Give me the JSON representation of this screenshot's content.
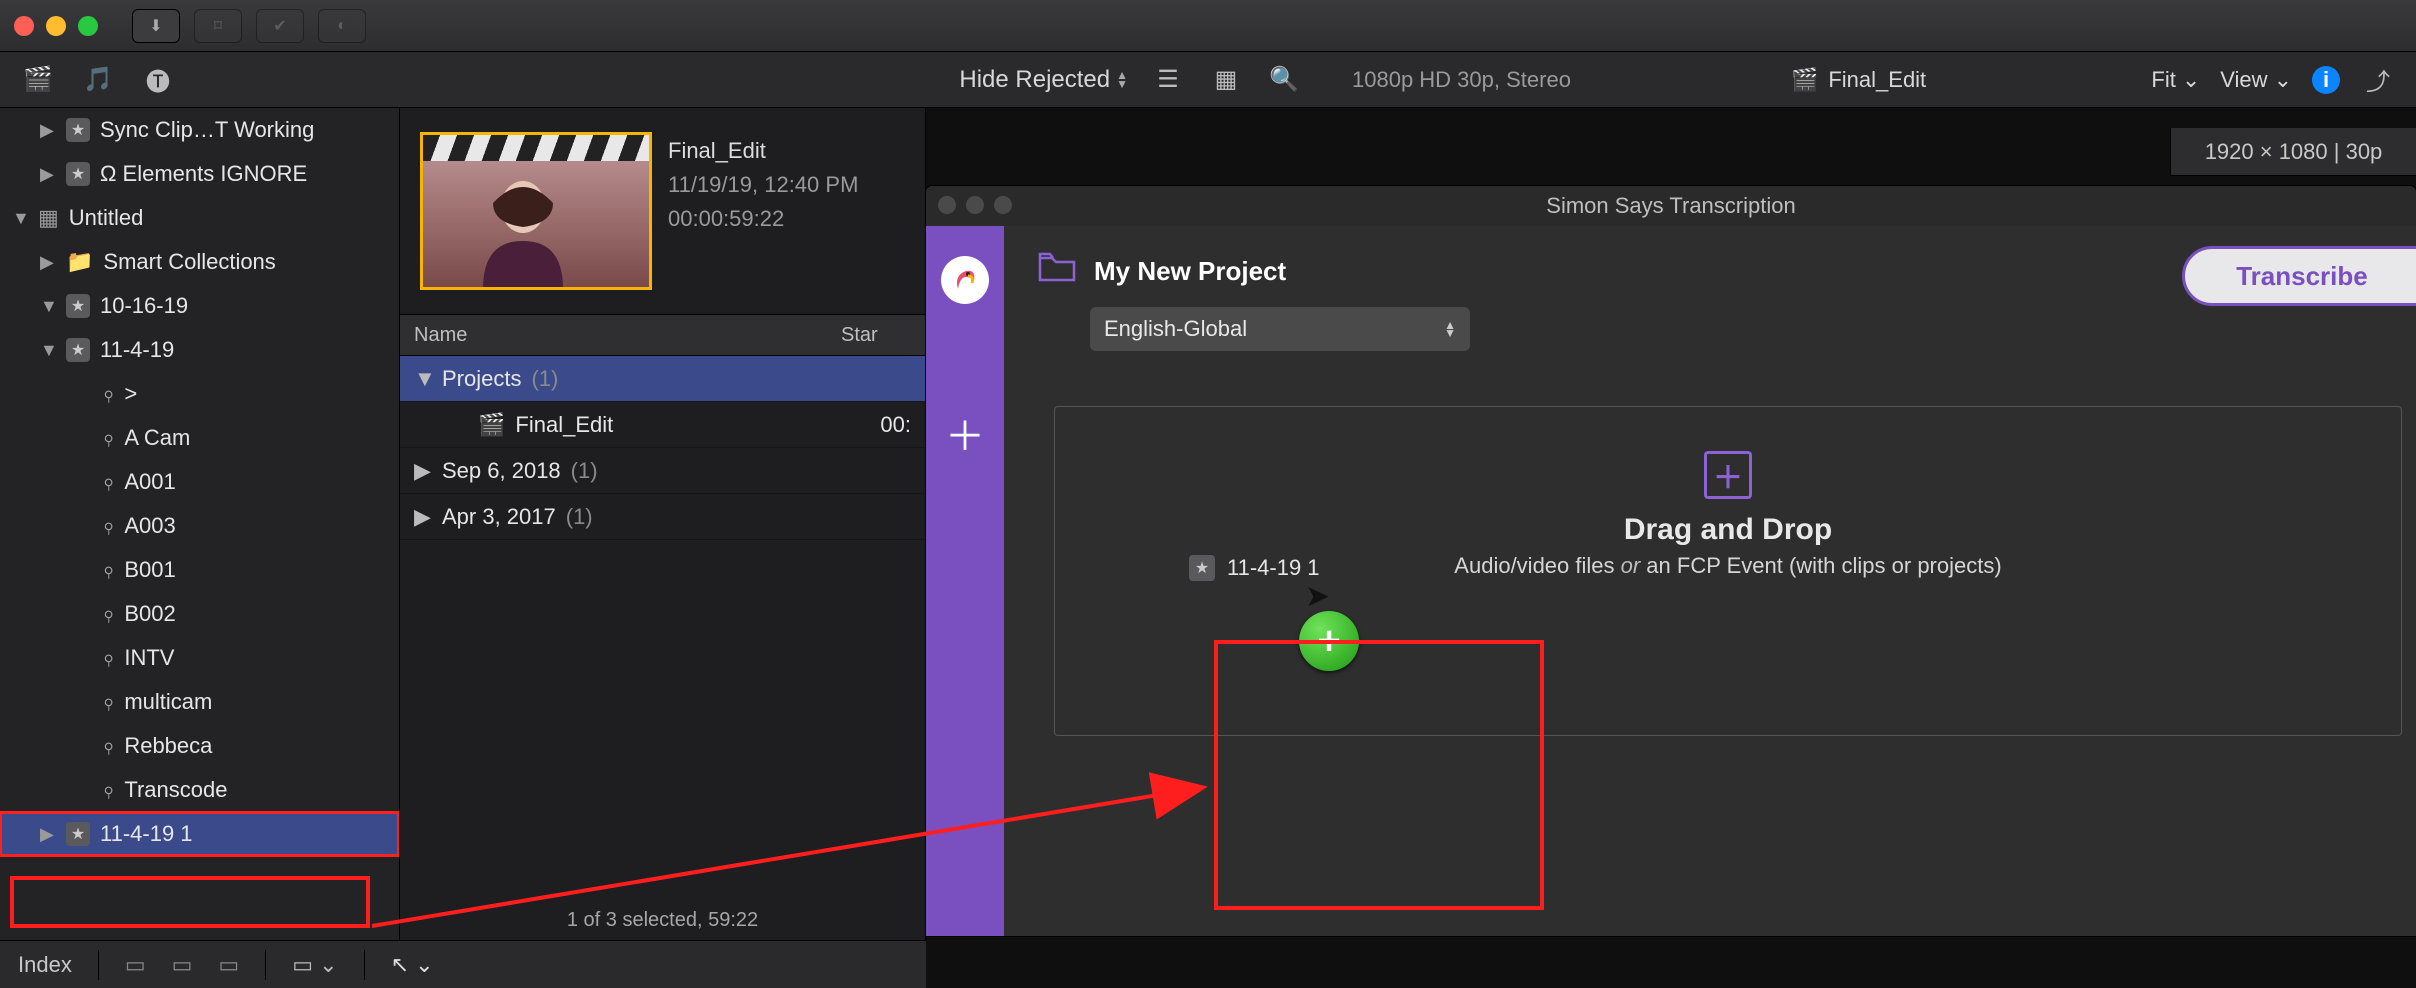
{
  "toolbar": {
    "import_icon": "import-icon",
    "keyword_icon": "key-icon",
    "check_icon": "check-icon",
    "silhouette_icon": "silhouette-icon"
  },
  "row2": {
    "media_icon": "movie-icon",
    "music_icon": "music-icon",
    "titles_icon": "titles-icon",
    "clip_filter": "Hide Rejected",
    "format_info": "1080p HD 30p, Stereo",
    "project_name": "Final_Edit",
    "fit_menu": "Fit",
    "view_menu": "View",
    "resolution_pill": "1920 × 1080 | 30p"
  },
  "library": {
    "items": [
      {
        "kind": "event",
        "indent": 1,
        "label": "Sync Clip…T Working",
        "disclose": "▶"
      },
      {
        "kind": "event",
        "indent": 1,
        "label": "Ω Elements IGNORE",
        "disclose": "▶"
      },
      {
        "kind": "library",
        "indent": 0,
        "label": "Untitled",
        "disclose": "▼",
        "icon": "lib"
      },
      {
        "kind": "folder",
        "indent": 1,
        "label": "Smart Collections",
        "disclose": "▶",
        "icon": "folder"
      },
      {
        "kind": "event",
        "indent": 1,
        "label": "10-16-19",
        "disclose": "▼"
      },
      {
        "kind": "event",
        "indent": 1,
        "label": "11-4-19",
        "disclose": "▼"
      },
      {
        "kind": "keyword",
        "indent": 2,
        "label": ">"
      },
      {
        "kind": "keyword",
        "indent": 2,
        "label": "A Cam"
      },
      {
        "kind": "keyword",
        "indent": 2,
        "label": "A001"
      },
      {
        "kind": "keyword",
        "indent": 2,
        "label": "A003"
      },
      {
        "kind": "keyword",
        "indent": 2,
        "label": "B001"
      },
      {
        "kind": "keyword",
        "indent": 2,
        "label": "B002"
      },
      {
        "kind": "keyword",
        "indent": 2,
        "label": "INTV"
      },
      {
        "kind": "keyword",
        "indent": 2,
        "label": "multicam"
      },
      {
        "kind": "keyword",
        "indent": 2,
        "label": "Rebbeca"
      },
      {
        "kind": "keyword",
        "indent": 2,
        "label": "Transcode"
      },
      {
        "kind": "event",
        "indent": 1,
        "label": "11-4-19 1",
        "disclose": "▶",
        "selected": true,
        "highlighted": true
      }
    ]
  },
  "browser_footer": {
    "index_label": "Index"
  },
  "clip": {
    "name": "Final_Edit",
    "date": "11/19/19, 12:40 PM",
    "duration": "00:00:59:22"
  },
  "list": {
    "header_name": "Name",
    "header_start": "Star",
    "rows": [
      {
        "disc": "▼",
        "label": "Projects",
        "count": "(1)",
        "selected": true
      },
      {
        "disc": "",
        "label": "Final_Edit",
        "count": "",
        "sub": true,
        "start": "00:",
        "clapper": true
      },
      {
        "disc": "▶",
        "label": "Sep 6, 2018",
        "count": "(1)"
      },
      {
        "disc": "▶",
        "label": "Apr 3, 2017",
        "count": "(1)"
      }
    ],
    "selection_info": "1 of 3 selected, 59:22"
  },
  "simon": {
    "window_title": "Simon Says Transcription",
    "project_title": "My New Project",
    "language": "English-Global",
    "transcribe_label": "Transcribe",
    "dropzone_title": "Drag and Drop",
    "dropzone_sub_pre": "Audio/video files ",
    "dropzone_sub_or": "or",
    "dropzone_sub_post": " an FCP Event (with clips or projects)",
    "drag_item_label": "11-4-19 1"
  }
}
